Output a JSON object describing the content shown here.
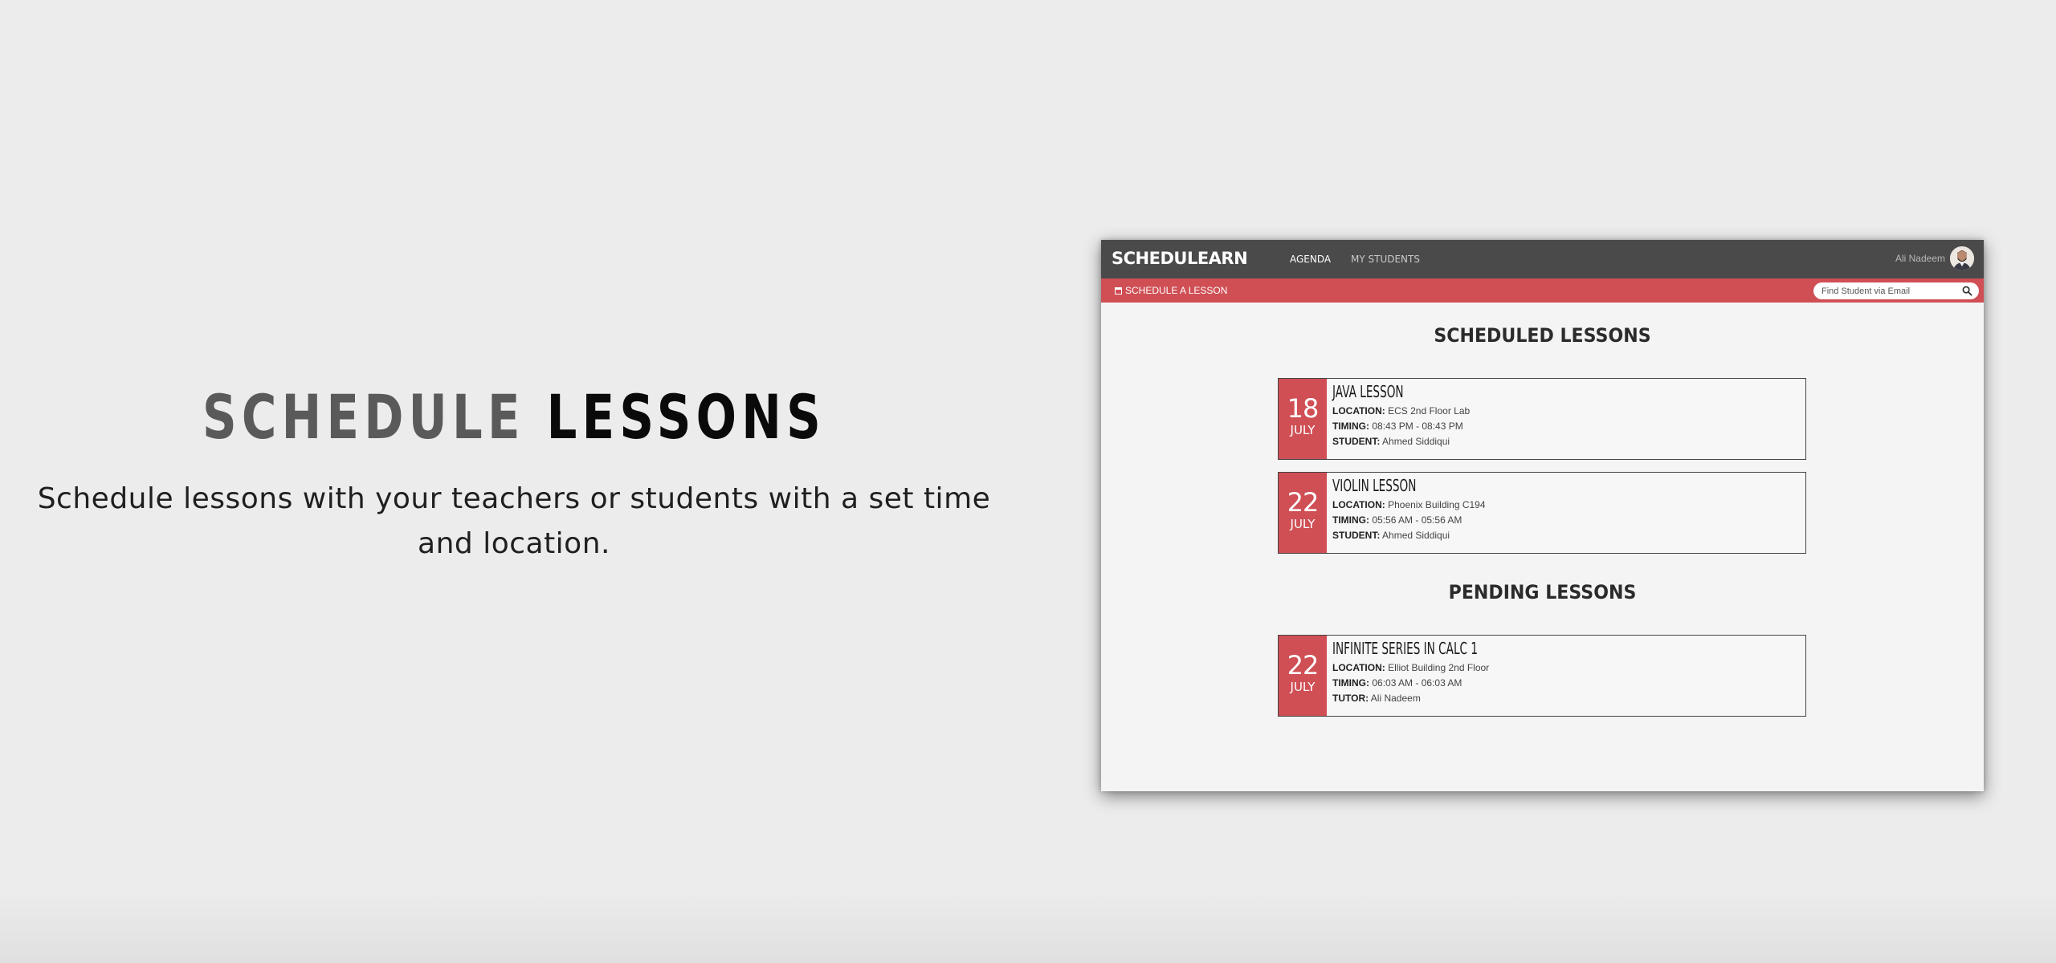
{
  "hero": {
    "title_word1": "SCHEDULE",
    "title_word2": "LESSONS",
    "subtitle": "Schedule lessons with your teachers or students with a set time and location."
  },
  "app": {
    "brand": "SCHEDULEARN",
    "nav": {
      "agenda": "AGENDA",
      "my_students": "MY STUDENTS"
    },
    "user_name": "Ali Nadeem",
    "schedule_link": "SCHEDULE A LESSON",
    "search": {
      "placeholder": "Find Student via Email",
      "value": ""
    },
    "scheduled_heading": "SCHEDULED LESSONS",
    "pending_heading": "PENDING LESSONS",
    "lessons": [
      {
        "day": "18",
        "month": "JULY",
        "title": "JAVA LESSON",
        "location_label": "LOCATION:",
        "location": "ECS 2nd Floor Lab",
        "timing_label": "TIMING:",
        "timing": "08:43 PM - 08:43 PM",
        "person_label": "STUDENT:",
        "person": "Ahmed Siddiqui"
      },
      {
        "day": "22",
        "month": "JULY",
        "title": "VIOLIN LESSON",
        "location_label": "LOCATION:",
        "location": "Phoenix Building C194",
        "timing_label": "TIMING:",
        "timing": "05:56 AM - 05:56 AM",
        "person_label": "STUDENT:",
        "person": "Ahmed Siddiqui"
      }
    ],
    "pending": [
      {
        "day": "22",
        "month": "JULY",
        "title": "INFINITE SERIES IN CALC 1",
        "location_label": "LOCATION:",
        "location": "Elliot Building 2nd Floor",
        "timing_label": "TIMING:",
        "timing": "06:03 AM - 06:03 AM",
        "person_label": "TUTOR:",
        "person": "Ali Nadeem"
      }
    ],
    "colors": {
      "accent": "#cf4f55",
      "topbar": "#4a4a4a"
    }
  }
}
